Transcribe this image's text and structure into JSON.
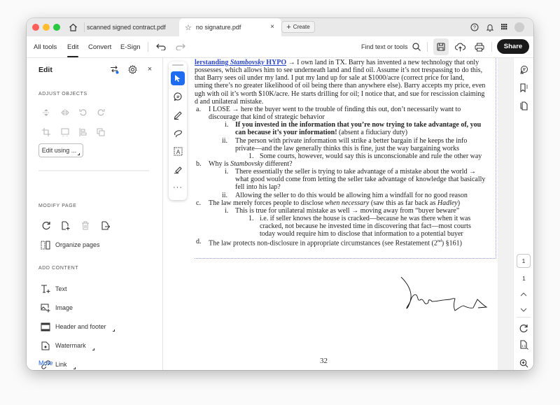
{
  "window": {
    "tabs": [
      {
        "label": "scanned signed contract.pdf",
        "active": false
      },
      {
        "label": "no signature.pdf",
        "active": true
      }
    ],
    "create_label": "Create",
    "close_tab_glyph": "×"
  },
  "toolbar": {
    "menus": [
      "All tools",
      "Edit",
      "Convert",
      "E-Sign"
    ],
    "active_menu": "Edit",
    "find_label": "Find text or tools",
    "share_label": "Share"
  },
  "panel": {
    "title": "Edit",
    "sections": {
      "adjust_objects": "ADJUST OBJECTS",
      "modify_page": "MODIFY PAGE",
      "add_content": "ADD CONTENT"
    },
    "edit_using_label": "Edit using ...",
    "organize_pages_label": "Organize pages",
    "add_content_items": [
      {
        "label": "Text",
        "icon": "add-text-icon",
        "has_menu": false
      },
      {
        "label": "Image",
        "icon": "add-image-icon",
        "has_menu": false
      },
      {
        "label": "Header and footer",
        "icon": "header-footer-icon",
        "has_menu": true
      },
      {
        "label": "Watermark",
        "icon": "watermark-icon",
        "has_menu": true
      },
      {
        "label": "Link",
        "icon": "link-icon",
        "has_menu": true
      }
    ],
    "more_label": "More",
    "more_color": "#1d5ed8"
  },
  "document": {
    "lines": [
      {
        "marker": "",
        "segments": [
          {
            "t": "lerstanding ",
            "s": "lnk"
          },
          {
            "t": "Stambovsky",
            "s": "lnk it"
          },
          {
            "t": " HYPO",
            "s": "lnk"
          },
          {
            "t": " → I own land in TX.  Barry has invented a new technology that only",
            "s": ""
          }
        ]
      },
      {
        "marker": "",
        "segments": [
          {
            "t": "possesses, which allows him to see underneath land and find oil.  Assume it’s not trespassing to do this,",
            "s": ""
          }
        ]
      },
      {
        "marker": "",
        "segments": [
          {
            "t": " that Barry sees oil under my land.  I put my land up for sale at $1000/acre (correct price for land,",
            "s": ""
          }
        ]
      },
      {
        "marker": "",
        "segments": [
          {
            "t": "uming there’s no greater likelihood of oil being there than anywhere else).  Barry accepts my price, even",
            "s": ""
          }
        ]
      },
      {
        "marker": "",
        "segments": [
          {
            "t": "ugh with oil it’s worth $10K/acre.  He starts drilling for oil; I notice that, and sue for rescission claiming",
            "s": ""
          }
        ]
      },
      {
        "marker": "",
        "segments": [
          {
            "t": "d and unilateral mistake.",
            "s": ""
          }
        ]
      },
      {
        "marker": "a.",
        "segments": [
          {
            "t": "I LOSE → here the buyer went to the trouble of finding this out, don’t necessarily want to",
            "s": ""
          }
        ]
      },
      {
        "marker": "",
        "segments": [
          {
            "t": "discourage that kind of strategic behavior",
            "s": ""
          }
        ]
      },
      {
        "marker": "i.",
        "segments": [
          {
            "t": "If you invested in the information that you’re now trying to take advantage of, you",
            "s": "b"
          }
        ]
      },
      {
        "marker": "",
        "segments": [
          {
            "t": "can because it’s your information!",
            "s": "b"
          },
          {
            "t": "  (absent a fiduciary duty)",
            "s": ""
          }
        ]
      },
      {
        "marker": "ii.",
        "segments": [
          {
            "t": "The person with private information will strike a better bargain if he keeps the info",
            "s": ""
          }
        ]
      },
      {
        "marker": "",
        "segments": [
          {
            "t": "private—and the law generally thinks this is fine, just the way bargaining works",
            "s": ""
          }
        ]
      },
      {
        "marker": "1.",
        "segments": [
          {
            "t": "Some courts, however, would say this is unconscionable and rule the other way",
            "s": ""
          }
        ]
      },
      {
        "marker": "b.",
        "segments": [
          {
            "t": "Why is ",
            "s": ""
          },
          {
            "t": "Stambovsky",
            "s": "it"
          },
          {
            "t": " different?",
            "s": ""
          }
        ]
      },
      {
        "marker": "i.",
        "segments": [
          {
            "t": "There essentially the seller is trying to take advantage of a mistake about the world →",
            "s": ""
          }
        ]
      },
      {
        "marker": "",
        "segments": [
          {
            "t": "what good would come from letting the seller take advantage of knowledge that basically",
            "s": ""
          }
        ]
      },
      {
        "marker": "",
        "segments": [
          {
            "t": "fell into his lap?",
            "s": ""
          }
        ]
      },
      {
        "marker": "ii.",
        "segments": [
          {
            "t": "Allowing the seller to do this would be allowing him a windfall for no good reason",
            "s": ""
          }
        ]
      },
      {
        "marker": "c.",
        "segments": [
          {
            "t": "The law merely forces people to disclose ",
            "s": ""
          },
          {
            "t": "when necessary",
            "s": "it"
          },
          {
            "t": " (saw this as far back as ",
            "s": ""
          },
          {
            "t": "Hadley",
            "s": "it"
          },
          {
            "t": ")",
            "s": ""
          }
        ]
      },
      {
        "marker": "i.",
        "segments": [
          {
            "t": "This is true for unilateral mistake as well → moving away from “buyer beware”",
            "s": ""
          }
        ]
      },
      {
        "marker": "1.",
        "segments": [
          {
            "t": "i.e. if seller knows the house is cracked—because he was there when it was",
            "s": ""
          }
        ]
      },
      {
        "marker": "",
        "segments": [
          {
            "t": "cracked, not because he invested time in discovering that fact—most courts",
            "s": ""
          }
        ]
      },
      {
        "marker": "",
        "segments": [
          {
            "t": "today would require him to disclose that information to a potential buyer",
            "s": ""
          }
        ]
      },
      {
        "marker": "d.",
        "segments": [
          {
            "t": "The law protects non-disclosure in appropriate circumstances (see Restatement (2",
            "s": ""
          },
          {
            "t": "nd",
            "s": "sup"
          },
          {
            "t": ") §161)",
            "s": ""
          }
        ]
      }
    ],
    "page_number": "32"
  },
  "rail": {
    "current_page": "1",
    "total_pages": "1"
  }
}
